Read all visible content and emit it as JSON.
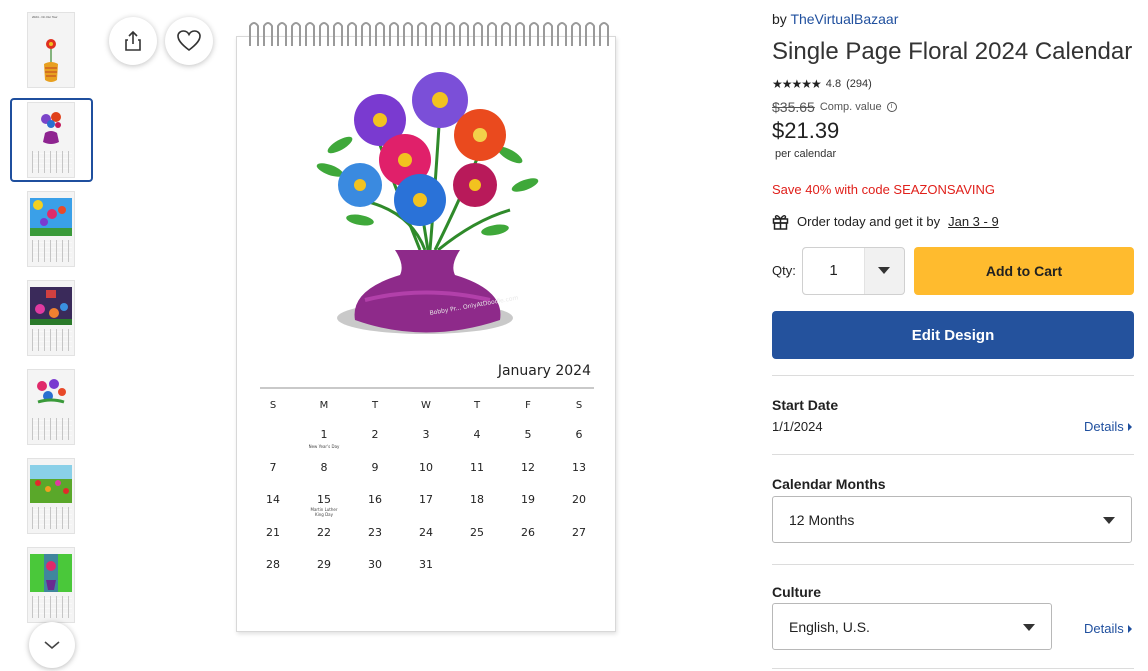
{
  "thumbnails": {
    "items": [
      {
        "label": "2024 - On Our Tow"
      },
      {
        "label": ""
      },
      {
        "label": ""
      },
      {
        "label": ""
      },
      {
        "label": ""
      },
      {
        "label": ""
      },
      {
        "label": ""
      }
    ],
    "selected_index": 1,
    "scroll_icon": "chevron-down-icon"
  },
  "actions": {
    "share_icon": "share-icon",
    "favorite_icon": "heart-icon"
  },
  "calendar": {
    "month": "January 2024",
    "weekdays": [
      "S",
      "M",
      "T",
      "W",
      "T",
      "F",
      "S"
    ],
    "weeks": [
      [
        "",
        "1",
        "2",
        "3",
        "4",
        "5",
        "6"
      ],
      [
        "7",
        "8",
        "9",
        "10",
        "11",
        "12",
        "13"
      ],
      [
        "14",
        "15",
        "16",
        "17",
        "18",
        "19",
        "20"
      ],
      [
        "21",
        "22",
        "23",
        "24",
        "25",
        "26",
        "27"
      ],
      [
        "28",
        "29",
        "30",
        "31",
        "",
        "",
        ""
      ]
    ],
    "notes": {
      "jan1": "New Year's Day",
      "jan15_line1": "Martin Luther",
      "jan15_line2": "King Day"
    },
    "artwork_signature": "Bobby Pr... OnlyAtDoodle.com"
  },
  "product": {
    "by_label": "by",
    "seller": "TheVirtualBazaar",
    "title": "Single Page Floral 2024 Calendar",
    "stars": "★★★★★",
    "rating": "4.8",
    "review_count": "(294)",
    "comp_price": "$35.65",
    "comp_label": "Comp. value",
    "price": "$21.39",
    "per_unit": "per calendar",
    "promo": "Save 40% with code SEAZONSAVING",
    "delivery_prefix": "Order today and get it by",
    "delivery_dates": "Jan 3 - 9"
  },
  "purchase": {
    "qty_label": "Qty:",
    "qty_value": "1",
    "add_to_cart": "Add to Cart",
    "edit_design": "Edit Design"
  },
  "options": {
    "start_date_label": "Start Date",
    "start_date_value": "1/1/2024",
    "details_label": "Details",
    "months_label": "Calendar Months",
    "months_value": "12 Months",
    "culture_label": "Culture",
    "culture_value": "English, U.S."
  },
  "colors": {
    "accent_blue": "#24529d",
    "link_blue": "#1f4f9e",
    "cart_yellow": "#ffbb2e",
    "promo_red": "#e0201b"
  }
}
